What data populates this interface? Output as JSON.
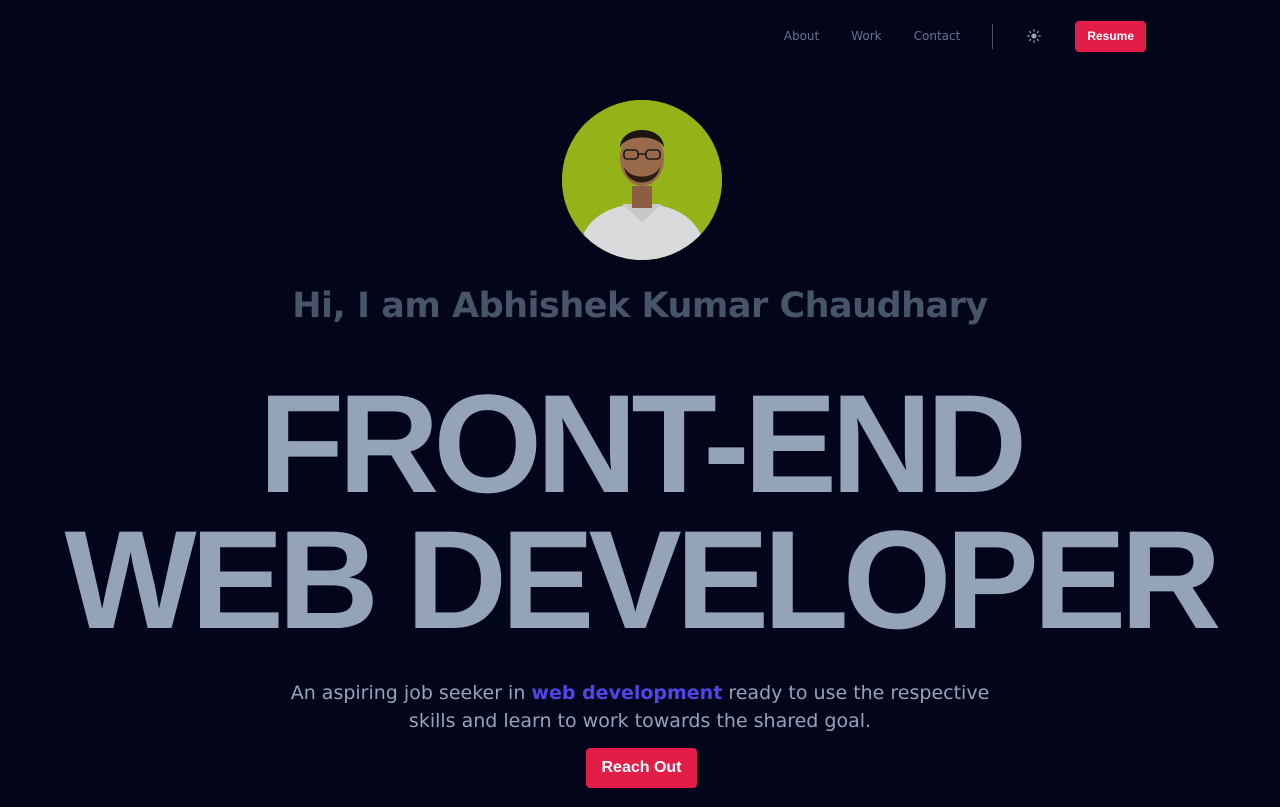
{
  "nav": {
    "links": [
      {
        "label": "About"
      },
      {
        "label": "Work"
      },
      {
        "label": "Contact"
      }
    ],
    "theme_icon": "sun-icon",
    "resume_label": "Resume"
  },
  "hero": {
    "greeting": "Hi, I am Abhishek Kumar Chaudhary",
    "title_line1": "FRONT-END",
    "title_line2": "WEB DEVELOPER",
    "tagline_before": "An aspiring job seeker in ",
    "tagline_highlight": "web development",
    "tagline_after": " ready to use the respective skills and learn to work towards the shared goal.",
    "cta_label": "Reach Out"
  },
  "colors": {
    "background": "#03061a",
    "accent": "#e11d48",
    "highlight": "#4f46e5",
    "title": "#94a3b8",
    "muted": "#64748b"
  }
}
